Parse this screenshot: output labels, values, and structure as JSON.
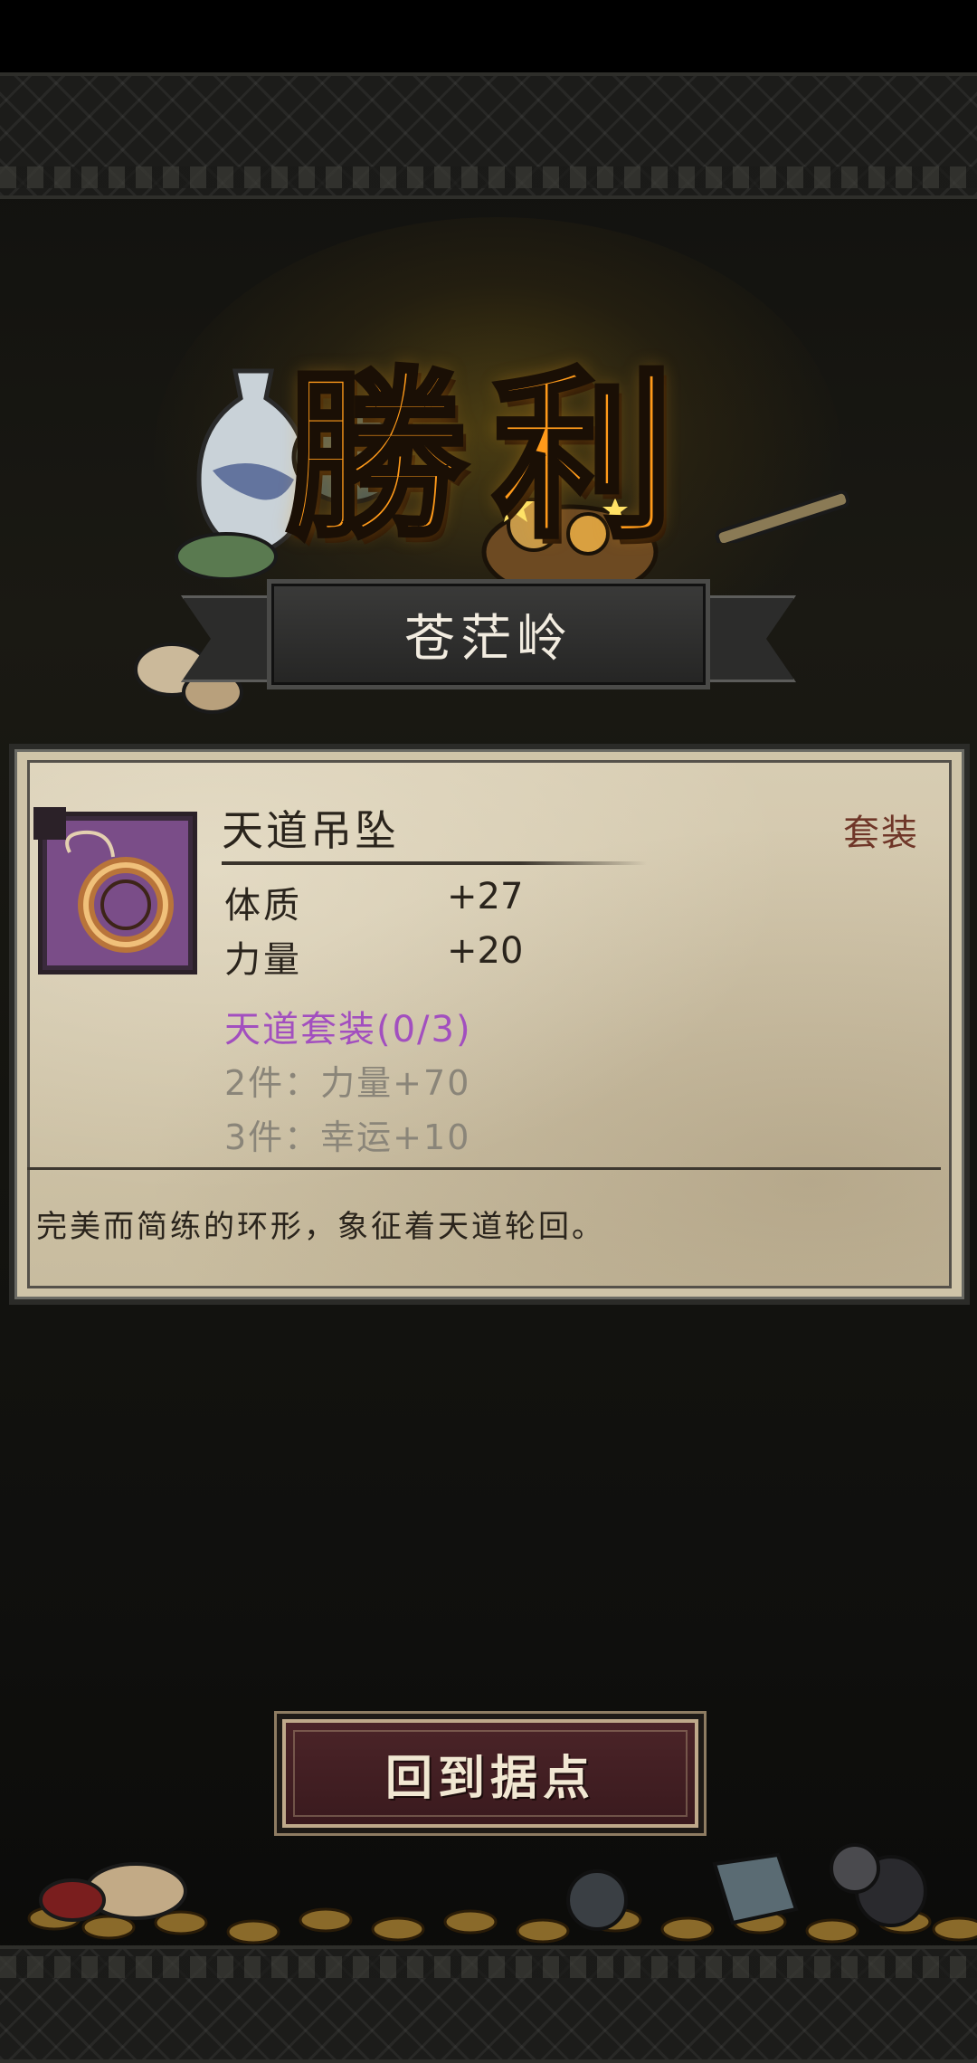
{
  "screen": {
    "title": "勝利",
    "location": "苍茫岭"
  },
  "item": {
    "name": "天道吊坠",
    "type": "套装",
    "stats": [
      {
        "label": "体质",
        "value": "+27"
      },
      {
        "label": "力量",
        "value": "+20"
      }
    ],
    "set": {
      "title": "天道套装(0/3)",
      "bonuses": [
        "2件：力量+70",
        "3件：幸运+10"
      ]
    },
    "description": "完美而简练的环形，象征着天道轮回。",
    "icon": "ring-pendant-icon"
  },
  "actions": {
    "return_label": "回到据点"
  },
  "colors": {
    "title": "#ff9a1a",
    "set_title": "#a24fbf",
    "item_type": "#6f3628",
    "icon_bg": "#7a4d88",
    "button_bg": "#4b2428"
  }
}
